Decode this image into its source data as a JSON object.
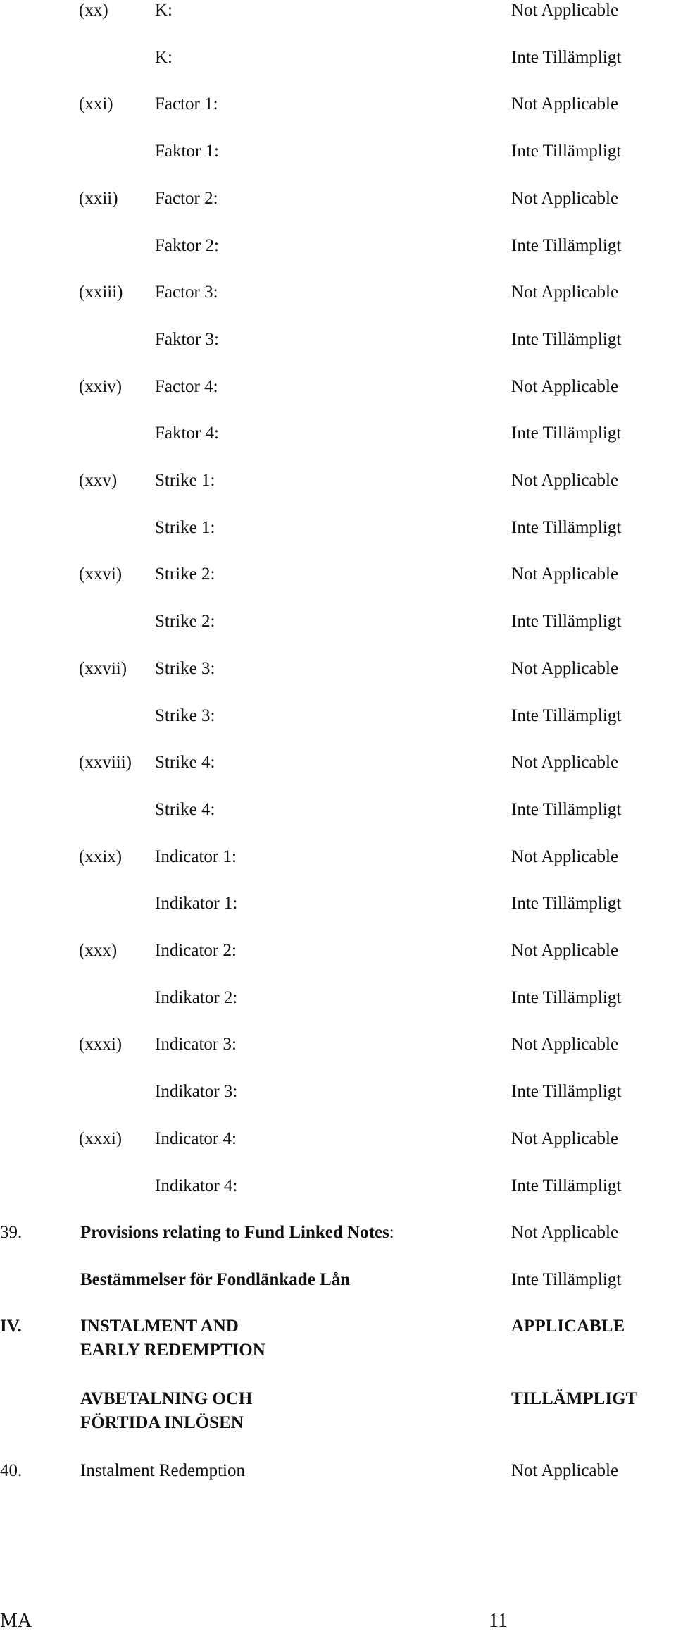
{
  "items": [
    {
      "num": "(xx)",
      "label": "K:",
      "value": "Not Applicable"
    },
    {
      "num": "",
      "label": "K:",
      "value": "Inte Tillämpligt"
    },
    {
      "num": "(xxi)",
      "label": "Factor 1:",
      "value": "Not Applicable"
    },
    {
      "num": "",
      "label": "Faktor 1:",
      "value": "Inte Tillämpligt"
    },
    {
      "num": "(xxii)",
      "label": "Factor 2:",
      "value": "Not Applicable"
    },
    {
      "num": "",
      "label": "Faktor 2:",
      "value": "Inte Tillämpligt"
    },
    {
      "num": "(xxiii)",
      "label": "Factor 3:",
      "value": "Not Applicable"
    },
    {
      "num": "",
      "label": "Faktor 3:",
      "value": "Inte Tillämpligt"
    },
    {
      "num": "(xxiv)",
      "label": "Factor 4:",
      "value": "Not Applicable"
    },
    {
      "num": "",
      "label": "Faktor 4:",
      "value": "Inte Tillämpligt"
    },
    {
      "num": "(xxv)",
      "label": "Strike 1:",
      "value": "Not Applicable"
    },
    {
      "num": "",
      "label": "Strike 1:",
      "value": "Inte Tillämpligt"
    },
    {
      "num": "(xxvi)",
      "label": "Strike 2:",
      "value": "Not Applicable"
    },
    {
      "num": "",
      "label": "Strike 2:",
      "value": "Inte Tillämpligt"
    },
    {
      "num": "(xxvii)",
      "label": "Strike 3:",
      "value": "Not Applicable"
    },
    {
      "num": "",
      "label": "Strike 3:",
      "value": "Inte Tillämpligt"
    },
    {
      "num": "(xxviii)",
      "label": "Strike 4:",
      "value": "Not Applicable"
    },
    {
      "num": "",
      "label": "Strike 4:",
      "value": "Inte Tillämpligt"
    },
    {
      "num": "(xxix)",
      "label": "Indicator 1:",
      "value": "Not Applicable"
    },
    {
      "num": "",
      "label": "Indikator 1:",
      "value": "Inte Tillämpligt"
    },
    {
      "num": "(xxx)",
      "label": "Indicator 2:",
      "value": "Not Applicable"
    },
    {
      "num": "",
      "label": "Indikator 2:",
      "value": "Inte Tillämpligt"
    },
    {
      "num": "(xxxi)",
      "label": "Indicator 3:",
      "value": "Not Applicable"
    },
    {
      "num": "",
      "label": "Indikator 3:",
      "value": "Inte Tillämpligt"
    },
    {
      "num": "(xxxi)",
      "label": "Indicator 4:",
      "value": "Not Applicable"
    },
    {
      "num": "",
      "label": "Indikator 4:",
      "value": "Inte Tillämpligt"
    }
  ],
  "section39": {
    "num": "39.",
    "label": "Provisions relating to Fund Linked Notes",
    "colon": ":",
    "value": "Not Applicable",
    "label_sv": "Bestämmelser för Fondlänkade Lån",
    "value_sv": "Inte Tillämpligt"
  },
  "sectionIV": {
    "num": "IV.",
    "title": "INSTALMENT AND EARLY REDEMPTION",
    "value": "APPLICABLE",
    "title_sv": "AVBETALNING OCH FÖRTIDA INLÖSEN",
    "value_sv": "TILLÄMPLIGT"
  },
  "section40": {
    "num": "40.",
    "label": "Instalment Redemption",
    "value": "Not Applicable"
  },
  "footer": {
    "left": "MA",
    "page_number": "11"
  }
}
